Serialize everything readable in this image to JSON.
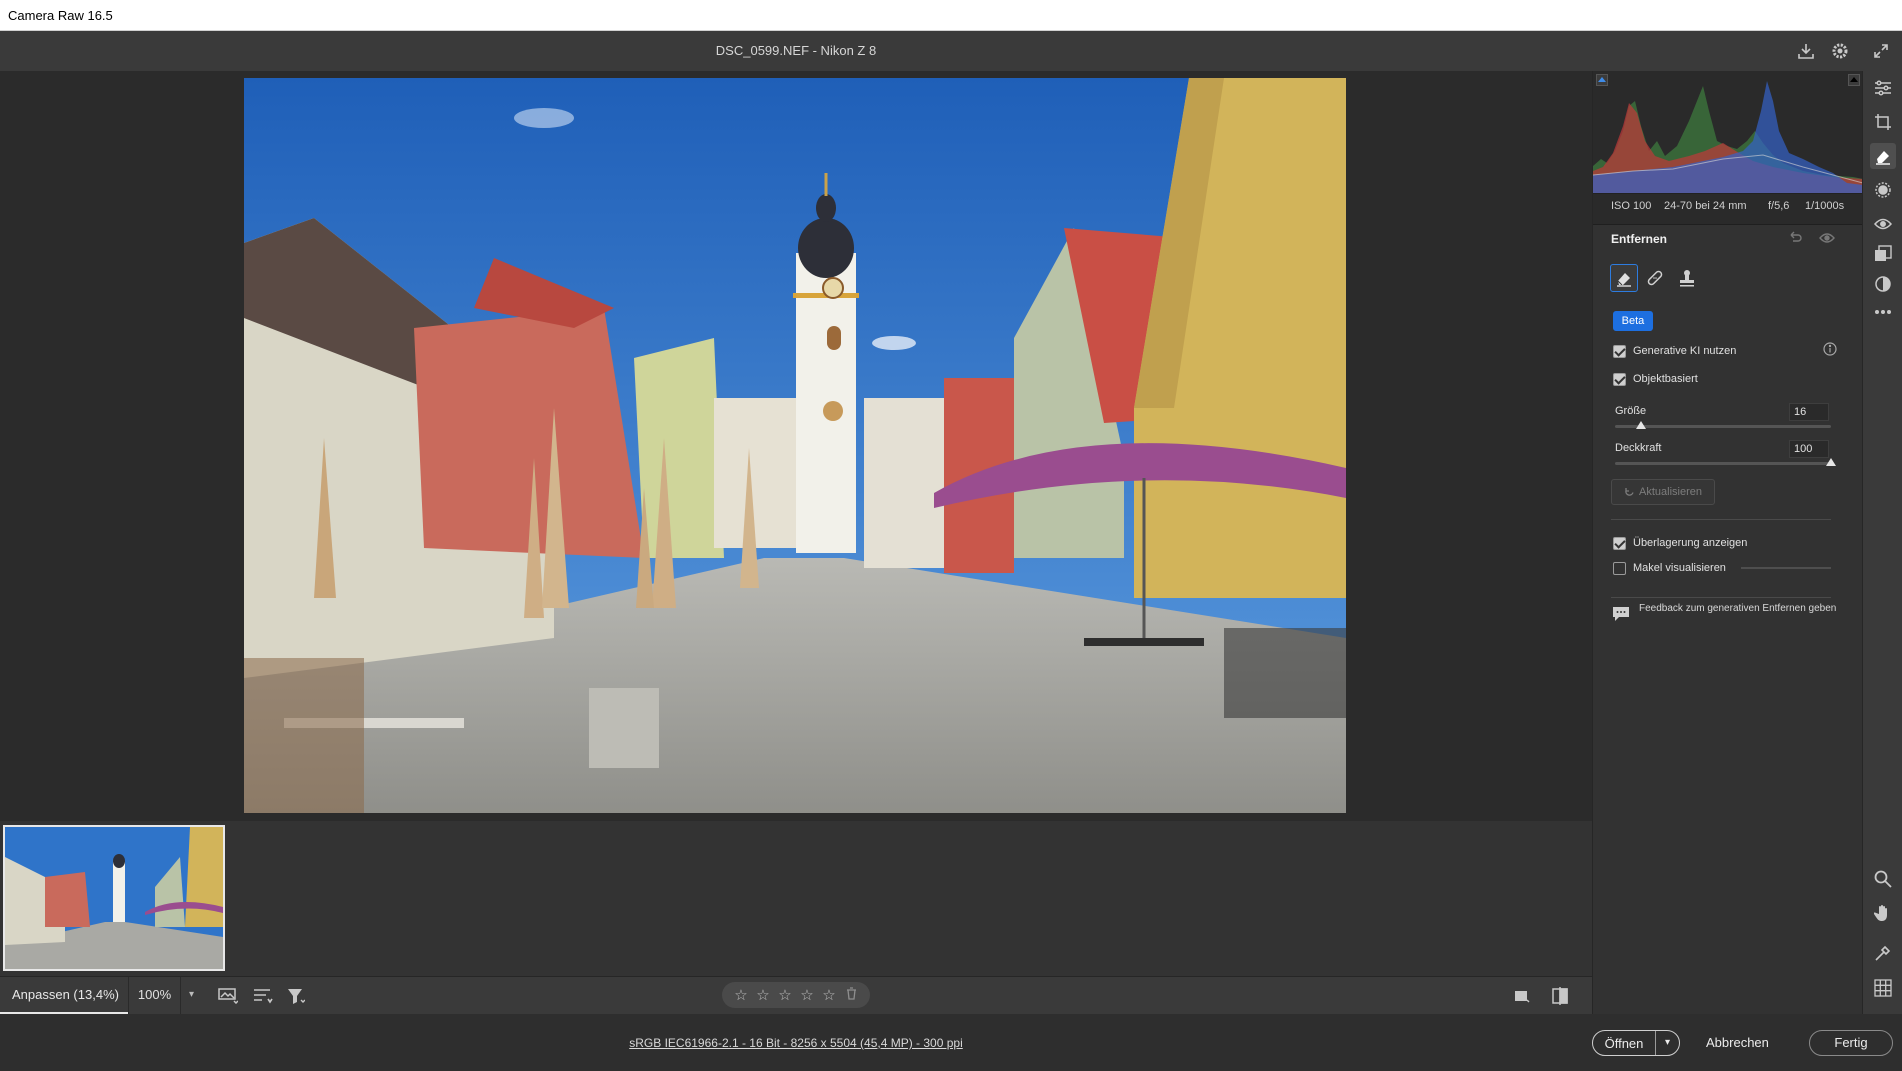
{
  "window": {
    "title": "Camera Raw 16.5"
  },
  "header": {
    "doc_title": "DSC_0599.NEF  -  Nikon Z 8"
  },
  "exif": {
    "iso": "ISO 100",
    "lens": "24-70 bei 24 mm",
    "aperture": "f/5,6",
    "shutter": "1/1000s"
  },
  "panel": {
    "title": "Entfernen",
    "badge": "Beta",
    "generative_ai": {
      "label": "Generative KI nutzen",
      "checked": true
    },
    "object_based": {
      "label": "Objektbasiert",
      "checked": true
    },
    "size": {
      "label": "Größe",
      "value": "16",
      "fraction": 0.12
    },
    "opacity": {
      "label": "Deckkraft",
      "value": "100",
      "fraction": 1.0
    },
    "update_button": "Aktualisieren",
    "show_overlay": {
      "label": "Überlagerung anzeigen",
      "checked": true
    },
    "visualize_spots": {
      "label": "Makel visualisieren",
      "checked": false
    },
    "feedback": "Feedback zum generativen Entfernen geben"
  },
  "toolbar": {
    "zoom_fit": "Anpassen (13,4%)",
    "zoom_100": "100%",
    "rating_stars": [
      "☆",
      "☆",
      "☆",
      "☆",
      "☆"
    ]
  },
  "status": {
    "file_info": "sRGB IEC61966-2.1 - 16 Bit - 8256 x 5504 (45,4 MP) - 300 ppi"
  },
  "actions": {
    "open": "Öffnen",
    "cancel": "Abbrechen",
    "done": "Fertig"
  },
  "colors": {
    "accent": "#1d6fe0",
    "sky": "#2f74c9",
    "umbrella": "#9a4d8f"
  },
  "icons": {
    "header": [
      "save-icon",
      "gear-icon",
      "fullscreen-icon"
    ],
    "rail": [
      "edit-sliders-icon",
      "crop-icon",
      "remove-eraser-icon",
      "masking-icon",
      "redeye-icon",
      "snapshots-icon",
      "presets-icon",
      "more-icon",
      "zoom-icon",
      "hand-icon",
      "color-sampler-icon",
      "grid-icon"
    ]
  }
}
